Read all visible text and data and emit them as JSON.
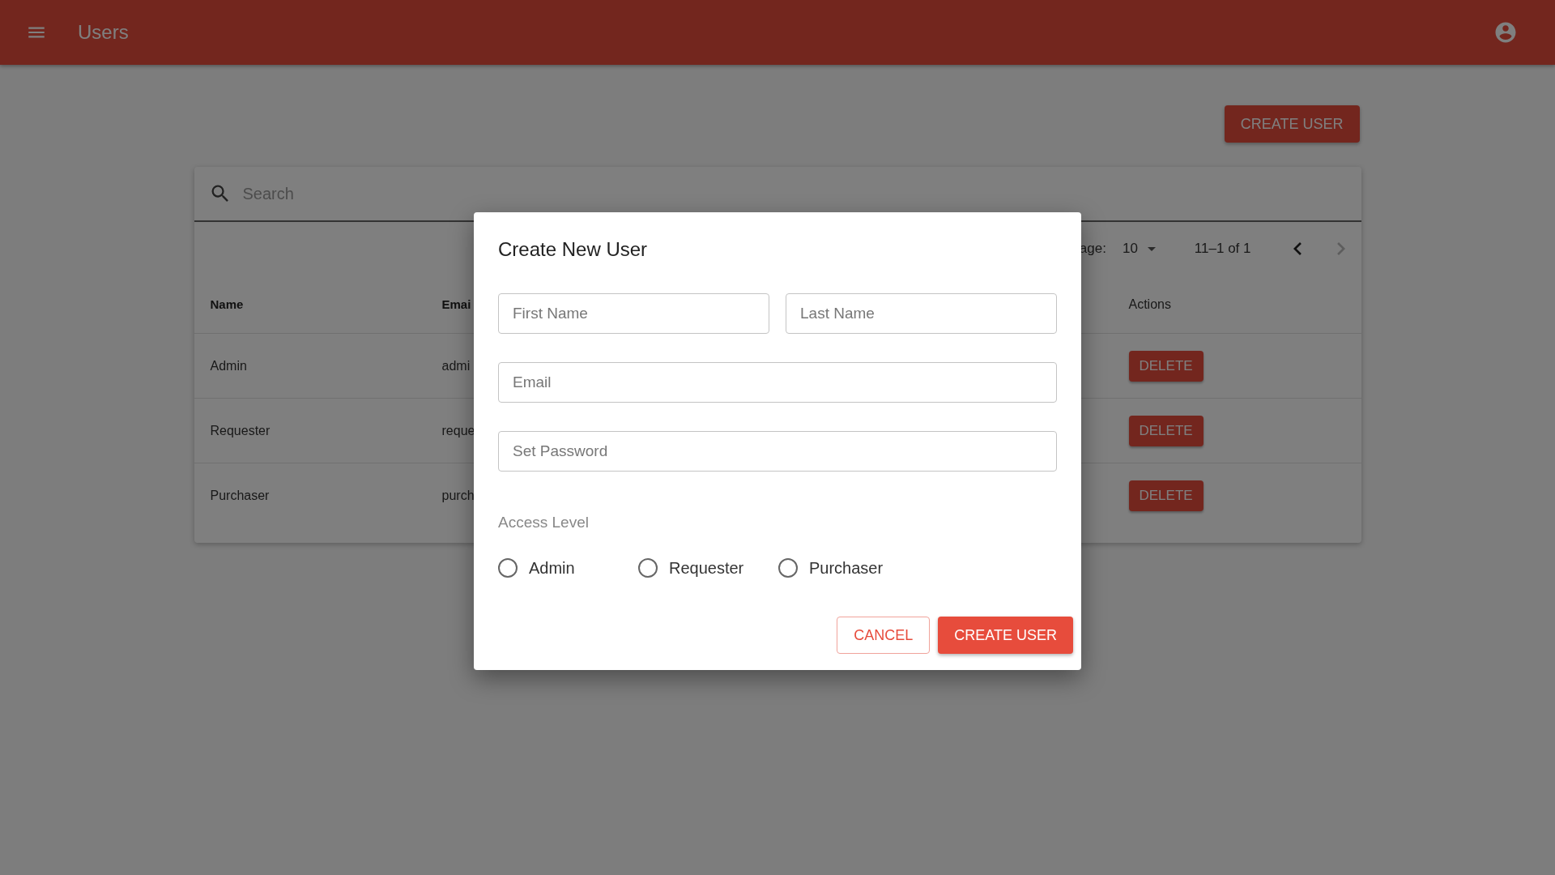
{
  "app_bar": {
    "title": "Users"
  },
  "create_button": {
    "label": "CREATE USER"
  },
  "search": {
    "placeholder": "Search"
  },
  "pagination": {
    "rows_label": "age:",
    "rows_value": "10",
    "range": "11–1 of 1",
    "prev_disabled": false,
    "next_disabled": true
  },
  "table": {
    "columns": [
      {
        "label": "Name",
        "kind": "bold"
      },
      {
        "label": "Emai",
        "kind": "bold"
      },
      {
        "label": "Actions",
        "kind": "plain"
      }
    ],
    "rows": [
      {
        "name": "Admin",
        "email": "admi",
        "action": "DELETE"
      },
      {
        "name": "Requester",
        "email": "reque",
        "action": "DELETE"
      },
      {
        "name": "Purchaser",
        "email": "purch",
        "action": "DELETE"
      }
    ]
  },
  "dialog": {
    "title": "Create New User",
    "fields": [
      {
        "placeholder": "First Name"
      },
      {
        "placeholder": "Last Name"
      },
      {
        "placeholder": "Email"
      },
      {
        "placeholder": "Set Password"
      }
    ],
    "access_label": "Access Level",
    "options": [
      {
        "label": "Admin",
        "selected": false
      },
      {
        "label": "Requester",
        "selected": false
      },
      {
        "label": "Purchaser",
        "selected": false
      }
    ],
    "buttons": [
      {
        "label": "CANCEL",
        "kind": "outlined"
      },
      {
        "label": "CREATE USER",
        "kind": "contained"
      }
    ]
  }
}
